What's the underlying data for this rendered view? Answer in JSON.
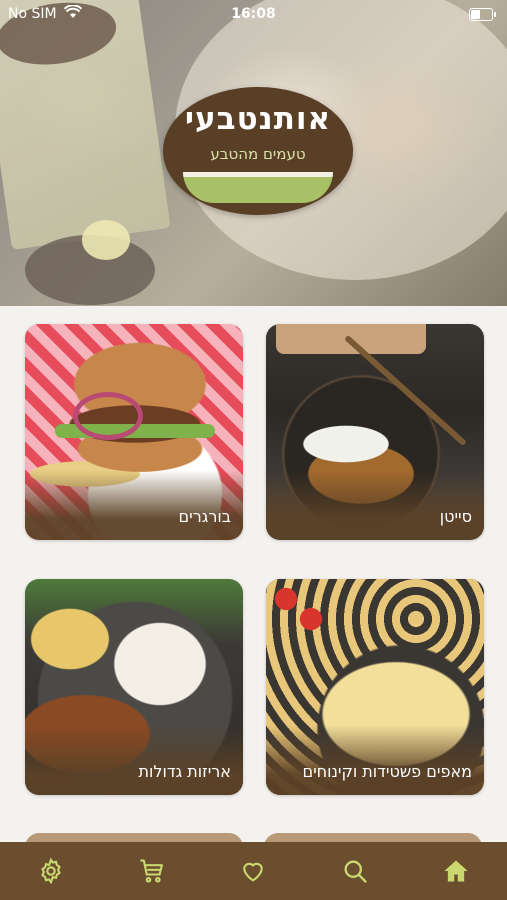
{
  "status_bar": {
    "carrier": "No SIM",
    "time": "16:08"
  },
  "hero": {
    "logo_name": "אותנטבעי",
    "logo_tagline": "טעמים מהטבע"
  },
  "categories": [
    {
      "label": "סייטן"
    },
    {
      "label": "בורגרים"
    },
    {
      "label": "מאפים פשטידות וקינוחים"
    },
    {
      "label": "אריזות גדולות"
    }
  ],
  "tab_bar": {
    "items": [
      {
        "icon": "gear-icon",
        "active": false
      },
      {
        "icon": "cart-icon",
        "active": false
      },
      {
        "icon": "heart-icon",
        "active": false
      },
      {
        "icon": "search-icon",
        "active": false
      },
      {
        "icon": "home-icon",
        "active": true
      }
    ]
  },
  "colors": {
    "brand_brown": "#6b4e2d",
    "icon_green": "#c9d86f",
    "card_label_band": "#5b4126"
  }
}
